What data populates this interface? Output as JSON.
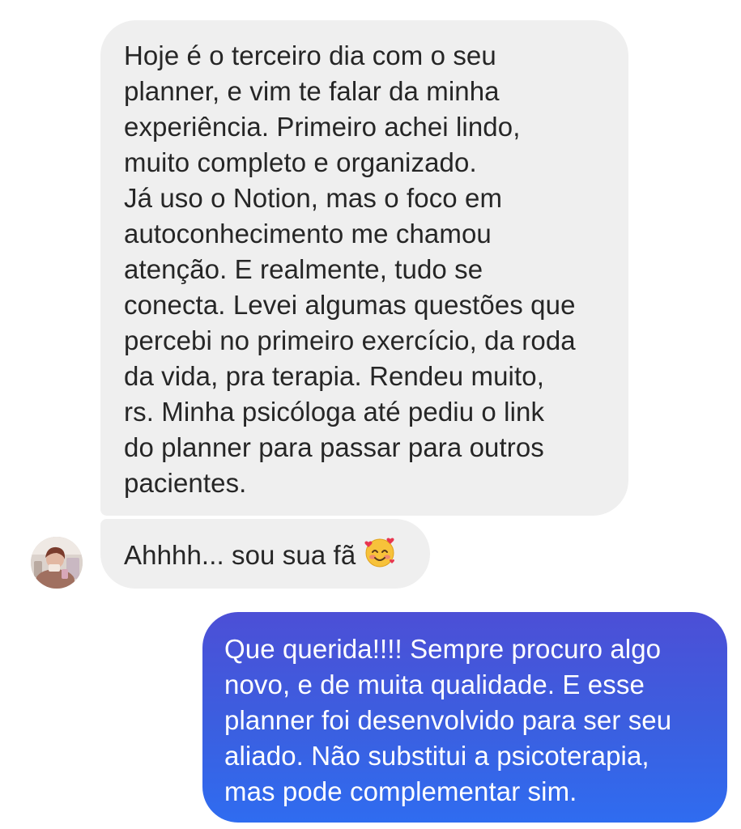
{
  "messages": {
    "received_long": {
      "lines": [
        "Hoje é o terceiro dia com o seu",
        "planner, e vim te falar da minha",
        "experiência. Primeiro achei lindo,",
        "muito completo e organizado.",
        "Já uso o Notion, mas o foco em",
        "autoconhecimento me chamou",
        "atenção. E realmente, tudo se",
        "conecta. Levei algumas questões que",
        "percebi no primeiro exercício, da roda",
        "da vida, pra terapia. Rendeu muito,",
        "rs. Minha psicóloga até pediu o link",
        "do planner para passar para outros",
        "pacientes."
      ]
    },
    "received_short": {
      "text": "Ahhhh... sou sua fã",
      "emoji": "smiling-face-with-hearts-icon"
    },
    "sent": {
      "lines": [
        "Que querida!!!! Sempre procuro algo",
        "novo, e de muita qualidade. E esse",
        "planner foi desenvolvido para ser seu",
        "aliado. Não substitui a psicoterapia,",
        "mas pode complementar sim."
      ]
    }
  },
  "colors": {
    "received_bubble": "#efefef",
    "received_text": "#262626",
    "sent_gradient_top": "#4c4fd6",
    "sent_gradient_bottom": "#2f6cf0",
    "sent_text": "#ffffff"
  }
}
